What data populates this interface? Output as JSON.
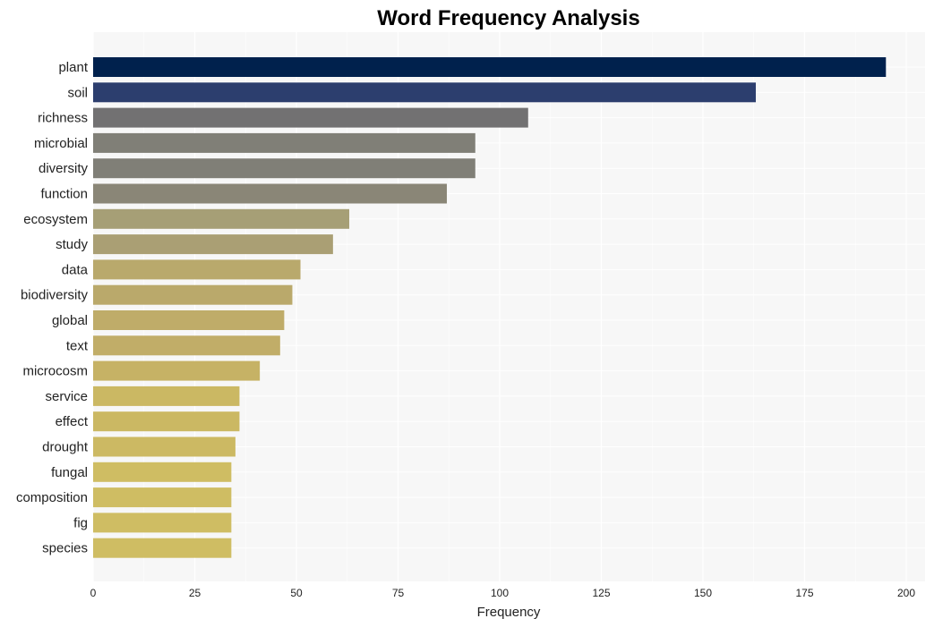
{
  "chart_data": {
    "type": "bar",
    "orientation": "horizontal",
    "title": "Word Frequency Analysis",
    "xlabel": "Frequency",
    "ylabel": "",
    "xlim": [
      0,
      205
    ],
    "xticks": [
      0,
      25,
      50,
      75,
      100,
      125,
      150,
      175,
      200
    ],
    "grid": true,
    "categories": [
      "plant",
      "soil",
      "richness",
      "microbial",
      "diversity",
      "function",
      "ecosystem",
      "study",
      "data",
      "biodiversity",
      "global",
      "text",
      "microcosm",
      "service",
      "effect",
      "drought",
      "fungal",
      "composition",
      "fig",
      "species"
    ],
    "values": [
      195,
      163,
      107,
      94,
      94,
      87,
      63,
      59,
      51,
      49,
      47,
      46,
      41,
      36,
      36,
      35,
      34,
      34,
      34,
      34
    ],
    "colors": [
      "#00214d",
      "#2c3e6e",
      "#727172",
      "#807f77",
      "#807f77",
      "#8a8677",
      "#a69f76",
      "#aa9f74",
      "#b9a96c",
      "#baa96b",
      "#bfac69",
      "#c1ad68",
      "#c6b265",
      "#cbb863",
      "#cbb863",
      "#ccb963",
      "#cfbd63",
      "#cfbd63",
      "#cfbd63",
      "#cfbd63"
    ]
  }
}
